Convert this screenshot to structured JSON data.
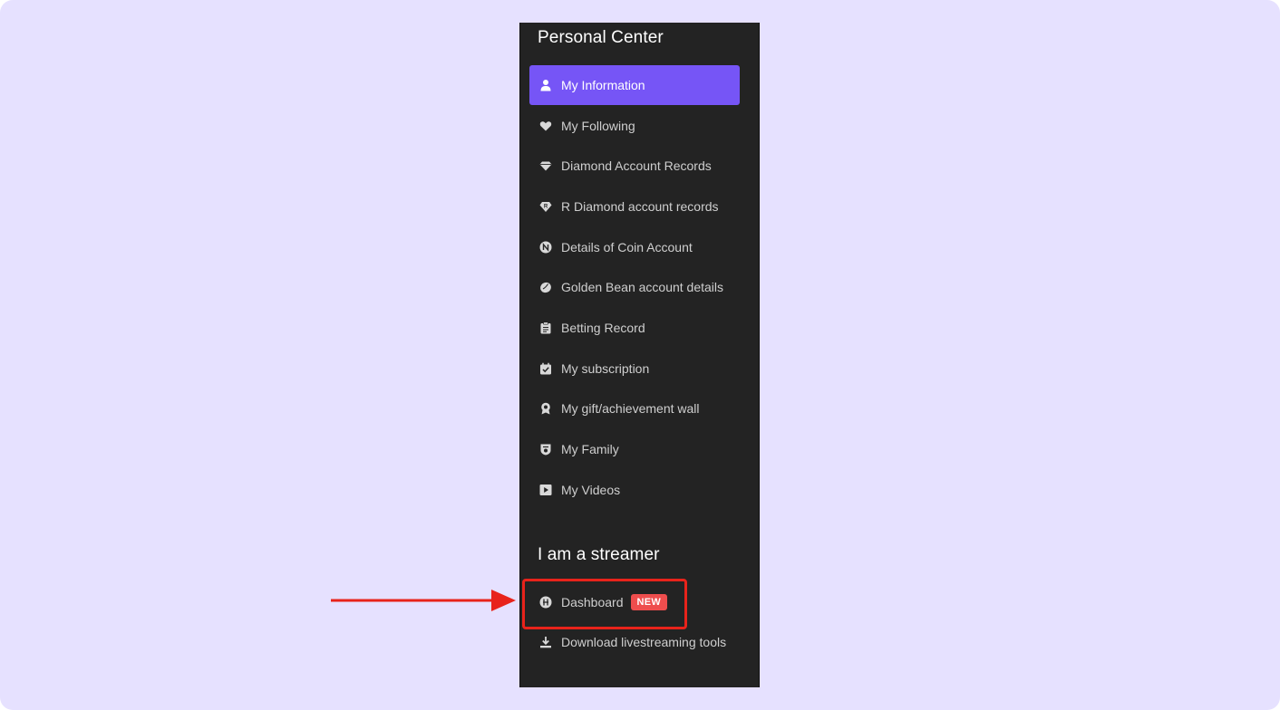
{
  "panel": {
    "personal_center_title": "Personal Center",
    "streamer_title": "I am a streamer",
    "accent_color": "#7655f6",
    "items": [
      {
        "label": "My Information",
        "icon": "person-icon",
        "active": true
      },
      {
        "label": "My Following",
        "icon": "heart-icon"
      },
      {
        "label": "Diamond Account Records",
        "icon": "diamond-icon"
      },
      {
        "label": "R Diamond account records",
        "icon": "r-diamond-icon"
      },
      {
        "label": "Details of Coin Account",
        "icon": "coin-icon"
      },
      {
        "label": "Golden Bean account details",
        "icon": "bean-icon"
      },
      {
        "label": "Betting Record",
        "icon": "clipboard-icon"
      },
      {
        "label": "My subscription",
        "icon": "subscription-icon"
      },
      {
        "label": "My gift/achievement wall",
        "icon": "medal-icon"
      },
      {
        "label": "My Family",
        "icon": "family-icon"
      },
      {
        "label": "My Videos",
        "icon": "video-play-icon"
      }
    ],
    "streamer_items": [
      {
        "label": "Dashboard",
        "icon": "dashboard-icon",
        "badge": "NEW",
        "badge_color": "#ee4d4d"
      },
      {
        "label": "Download livestreaming tools",
        "icon": "download-icon"
      }
    ]
  },
  "annotation": {
    "highlight_color": "#e8231b"
  }
}
